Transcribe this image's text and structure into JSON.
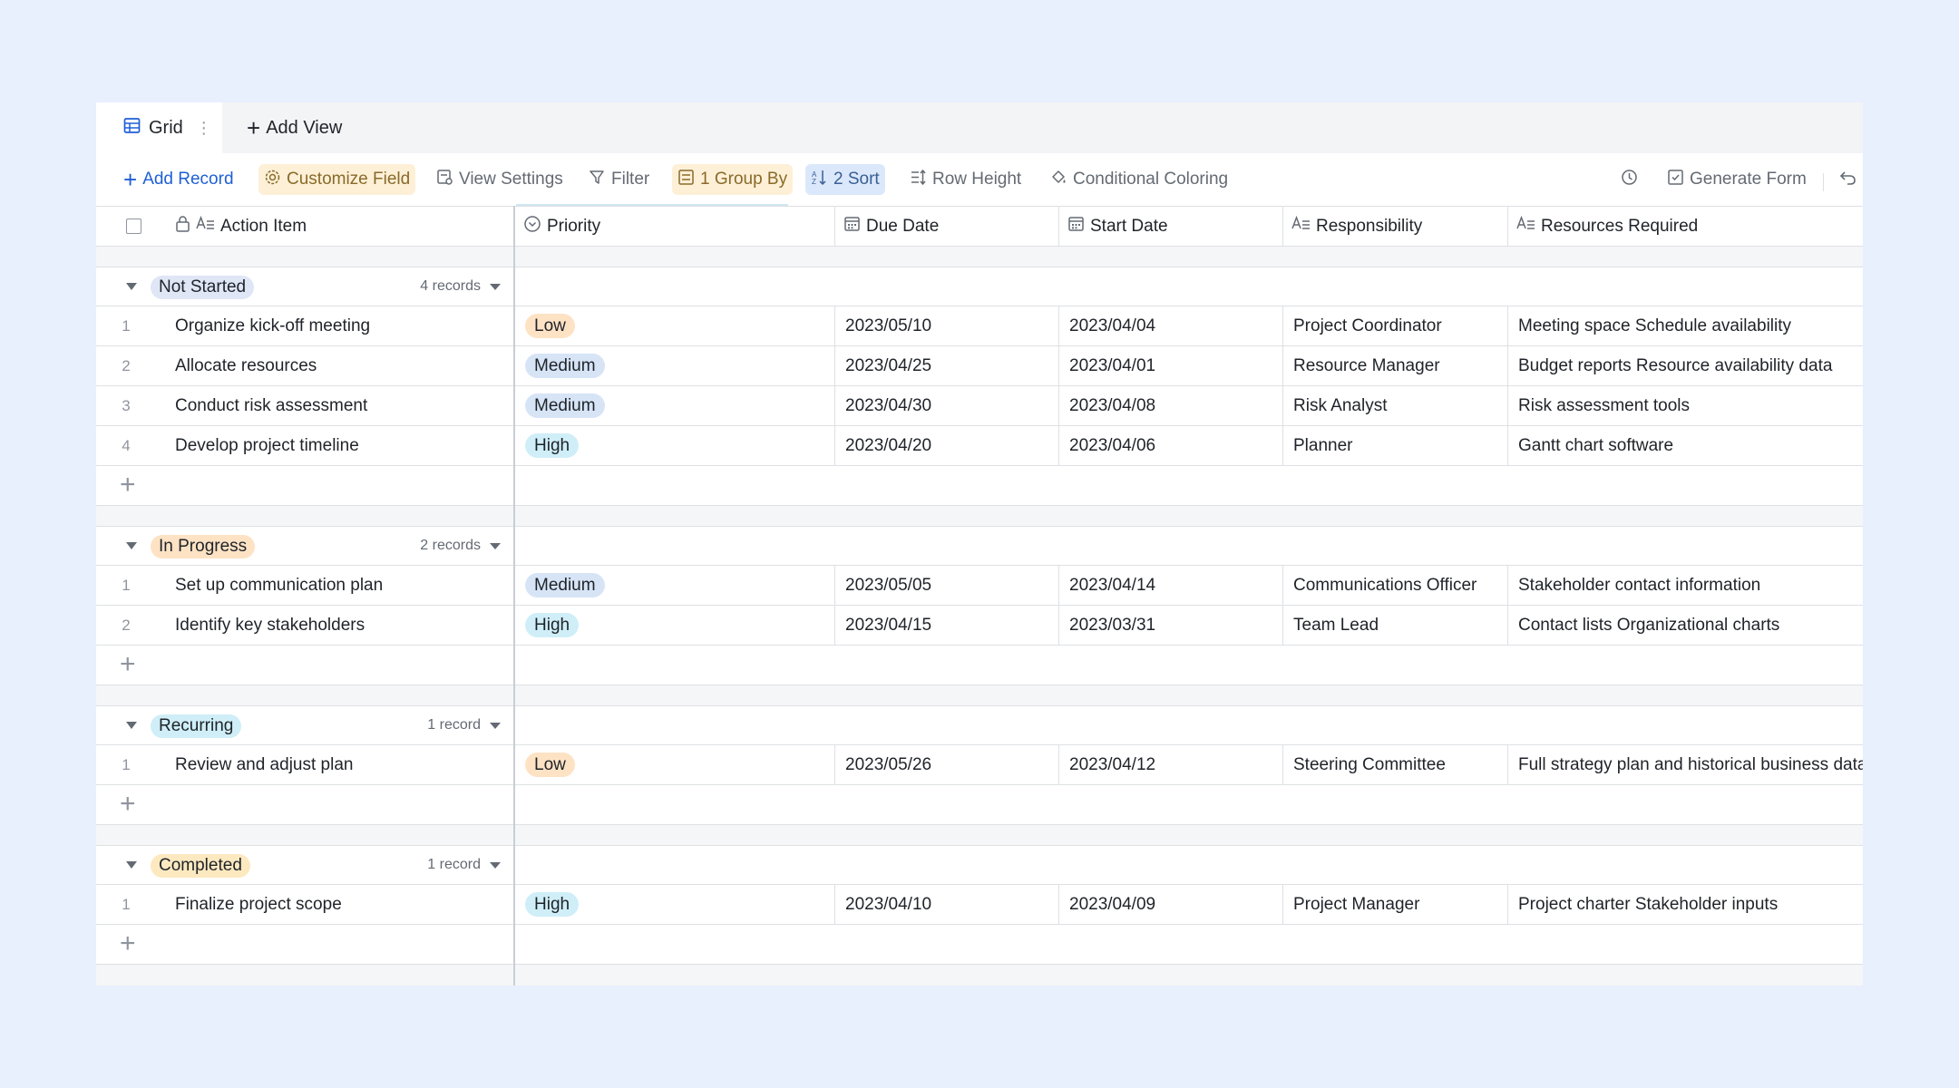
{
  "tabs": {
    "grid_label": "Grid",
    "add_view_label": "Add View"
  },
  "toolbar": {
    "add_record": "Add Record",
    "customize_field": "Customize Field",
    "view_settings": "View Settings",
    "filter": "Filter",
    "group_by": "1 Group By",
    "sort": "2 Sort",
    "row_height": "Row Height",
    "conditional_coloring": "Conditional Coloring",
    "generate_form": "Generate Form"
  },
  "columns": {
    "action_item": "Action Item",
    "priority": "Priority",
    "due_date": "Due Date",
    "start_date": "Start Date",
    "responsibility": "Responsibility",
    "resources_required": "Resources Required"
  },
  "priority_colors": {
    "Low": "#fde2c4",
    "Medium": "#d6e4f6",
    "High": "#cfeef8"
  },
  "groups": [
    {
      "name": "Not Started",
      "count": "4 records",
      "color": "#dfe6f6",
      "rows": [
        {
          "n": "1",
          "item": "Organize kick-off meeting",
          "priority": "Low",
          "due": "2023/05/10",
          "start": "2023/04/04",
          "resp": "Project Coordinator",
          "res": "Meeting space Schedule availability"
        },
        {
          "n": "2",
          "item": "Allocate resources",
          "priority": "Medium",
          "due": "2023/04/25",
          "start": "2023/04/01",
          "resp": "Resource Manager",
          "res": "Budget reports Resource availability data"
        },
        {
          "n": "3",
          "item": "Conduct risk assessment",
          "priority": "Medium",
          "due": "2023/04/30",
          "start": "2023/04/08",
          "resp": "Risk Analyst",
          "res": "Risk assessment tools"
        },
        {
          "n": "4",
          "item": "Develop project timeline",
          "priority": "High",
          "due": "2023/04/20",
          "start": "2023/04/06",
          "resp": "Planner",
          "res": "Gantt chart software"
        }
      ]
    },
    {
      "name": "In Progress",
      "count": "2 records",
      "color": "#fde2c4",
      "rows": [
        {
          "n": "1",
          "item": "Set up communication plan",
          "priority": "Medium",
          "due": "2023/05/05",
          "start": "2023/04/14",
          "resp": "Communications Officer",
          "res": "Stakeholder contact information"
        },
        {
          "n": "2",
          "item": "Identify key stakeholders",
          "priority": "High",
          "due": "2023/04/15",
          "start": "2023/03/31",
          "resp": "Team Lead",
          "res": "Contact lists Organizational charts"
        }
      ]
    },
    {
      "name": "Recurring",
      "count": "1 record",
      "color": "#cfeef8",
      "rows": [
        {
          "n": "1",
          "item": "Review and adjust plan",
          "priority": "Low",
          "due": "2023/05/26",
          "start": "2023/04/12",
          "resp": "Steering Committee",
          "res": "Full strategy plan and historical business data"
        }
      ]
    },
    {
      "name": "Completed",
      "count": "1 record",
      "color": "#fde9c0",
      "rows": [
        {
          "n": "1",
          "item": "Finalize project scope",
          "priority": "High",
          "due": "2023/04/10",
          "start": "2023/04/09",
          "resp": "Project Manager",
          "res": "Project charter Stakeholder inputs"
        }
      ]
    }
  ]
}
